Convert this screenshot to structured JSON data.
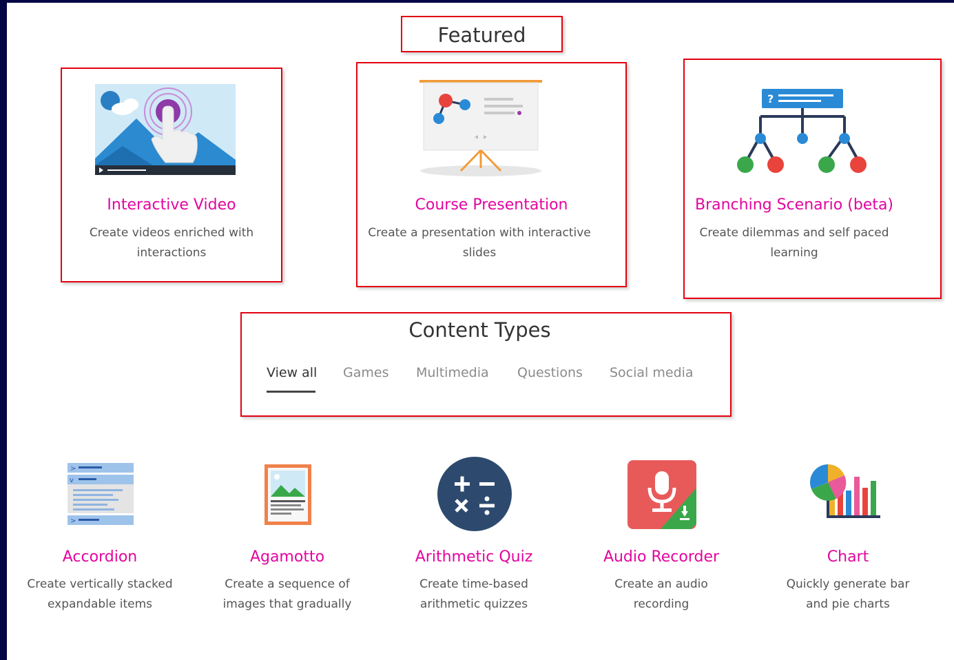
{
  "featured": {
    "heading": "Featured",
    "cards": [
      {
        "title": "Interactive Video",
        "desc": "Create videos enriched with interactions"
      },
      {
        "title": "Course Presentation",
        "desc": "Create a presentation with interactive slides"
      },
      {
        "title": "Branching Scenario (beta)",
        "desc": "Create dilemmas and self paced learning"
      }
    ]
  },
  "content_types": {
    "heading": "Content Types",
    "tabs": [
      {
        "label": "View all",
        "active": true
      },
      {
        "label": "Games",
        "active": false
      },
      {
        "label": "Multimedia",
        "active": false
      },
      {
        "label": "Questions",
        "active": false
      },
      {
        "label": "Social media",
        "active": false
      }
    ],
    "items": [
      {
        "title": "Accordion",
        "desc": "Create vertically stacked expandable items",
        "icon": "accordion-icon"
      },
      {
        "title": "Agamotto",
        "desc": "Create a sequence of images that gradually",
        "icon": "agamotto-icon"
      },
      {
        "title": "Arithmetic Quiz",
        "desc": "Create time-based arithmetic quizzes",
        "icon": "arithmetic-quiz-icon"
      },
      {
        "title": "Audio Recorder",
        "desc": "Create an audio recording",
        "icon": "audio-recorder-icon"
      },
      {
        "title": "Chart",
        "desc": "Quickly generate bar and pie charts",
        "icon": "chart-icon"
      }
    ]
  },
  "colors": {
    "title_accent": "#e2059e",
    "highlight_box": "#e3000f",
    "frame": "#020444"
  }
}
